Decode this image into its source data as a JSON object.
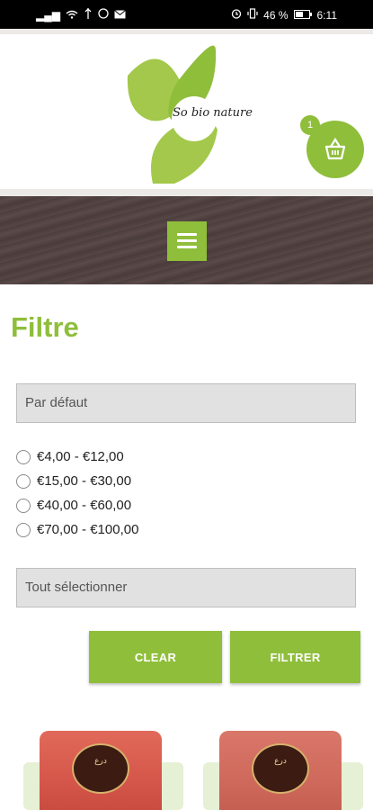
{
  "status_bar": {
    "left_signal": "▂▄▆",
    "battery_percent": "46 %",
    "time": "6:11"
  },
  "header": {
    "logo_text": "So bio nature",
    "cart_count": "1"
  },
  "filter": {
    "title": "Filtre",
    "sort_select": {
      "value": "Par défaut"
    },
    "price_ranges": [
      {
        "label": "€4,00 - €12,00"
      },
      {
        "label": "€15,00 - €30,00"
      },
      {
        "label": "€40,00 - €60,00"
      },
      {
        "label": "€70,00 - €100,00"
      }
    ],
    "category_select": {
      "value": "Tout sélectionner"
    },
    "clear_label": "CLEAR",
    "filter_label": "FILTRER"
  },
  "products": [
    {
      "label": "درع"
    },
    {
      "label": "درع"
    }
  ],
  "colors": {
    "accent": "#8fbe3b",
    "nav_band": "#4b3d3d",
    "select_bg": "#e1e1e1"
  }
}
